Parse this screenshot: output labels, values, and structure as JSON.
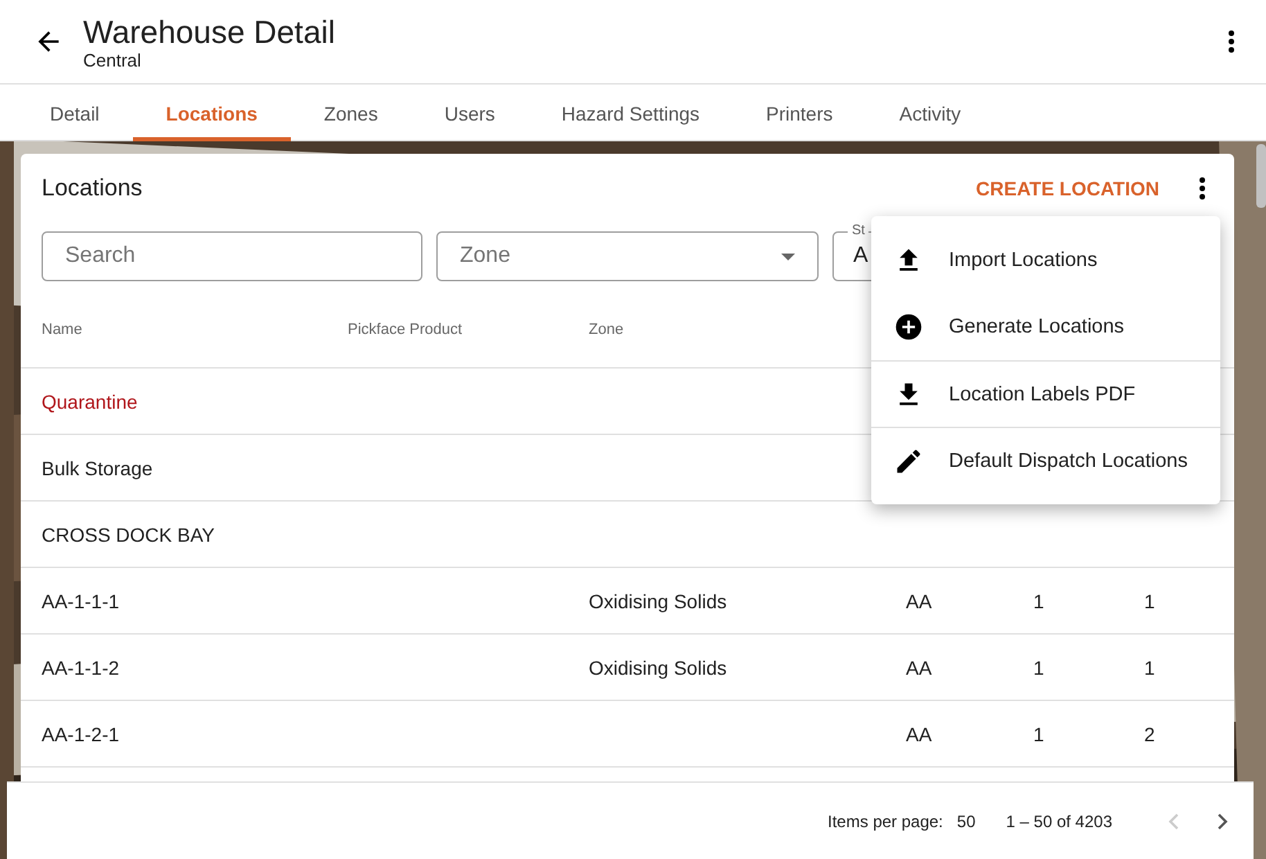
{
  "header": {
    "title": "Warehouse Detail",
    "subtitle": "Central"
  },
  "tabs": [
    {
      "label": "Detail",
      "selected": false
    },
    {
      "label": "Locations",
      "selected": true
    },
    {
      "label": "Zones",
      "selected": false
    },
    {
      "label": "Users",
      "selected": false
    },
    {
      "label": "Hazard Settings",
      "selected": false
    },
    {
      "label": "Printers",
      "selected": false
    },
    {
      "label": "Activity",
      "selected": false
    }
  ],
  "card": {
    "title": "Locations",
    "create_button": "CREATE LOCATION"
  },
  "filters": {
    "search": {
      "placeholder": "Search"
    },
    "zone": {
      "placeholder": "Zone"
    },
    "status": {
      "label": "St",
      "value": "A"
    }
  },
  "table": {
    "columns": [
      "Name",
      "Pickface Product",
      "Zone"
    ],
    "rows": [
      {
        "name": "Quarantine",
        "flagged": true
      },
      {
        "name": "Bulk Storage",
        "flagged": false
      },
      {
        "name": "CROSS DOCK BAY",
        "flagged": false
      },
      {
        "name": "AA-1-1-1",
        "flagged": false,
        "zone": "Oxidising Solids",
        "column_4": "AA",
        "column_5": "1",
        "column_6": "1"
      },
      {
        "name": "AA-1-1-2",
        "flagged": false,
        "zone": "Oxidising Solids",
        "column_4": "AA",
        "column_5": "1",
        "column_6": "1"
      },
      {
        "name": "AA-1-2-1",
        "flagged": false,
        "column_4": "AA",
        "column_5": "1",
        "column_6": "2"
      }
    ]
  },
  "menu": [
    {
      "kind": "upload",
      "label": "Import Locations"
    },
    {
      "kind": "add",
      "label": "Generate Locations"
    },
    {
      "kind": "download",
      "label": "Location Labels PDF"
    },
    {
      "kind": "edit",
      "label": "Default Dispatch Locations"
    }
  ],
  "paginator": {
    "label": "Items per page:",
    "page_size": "50",
    "range": "1 – 50 of 4203"
  }
}
